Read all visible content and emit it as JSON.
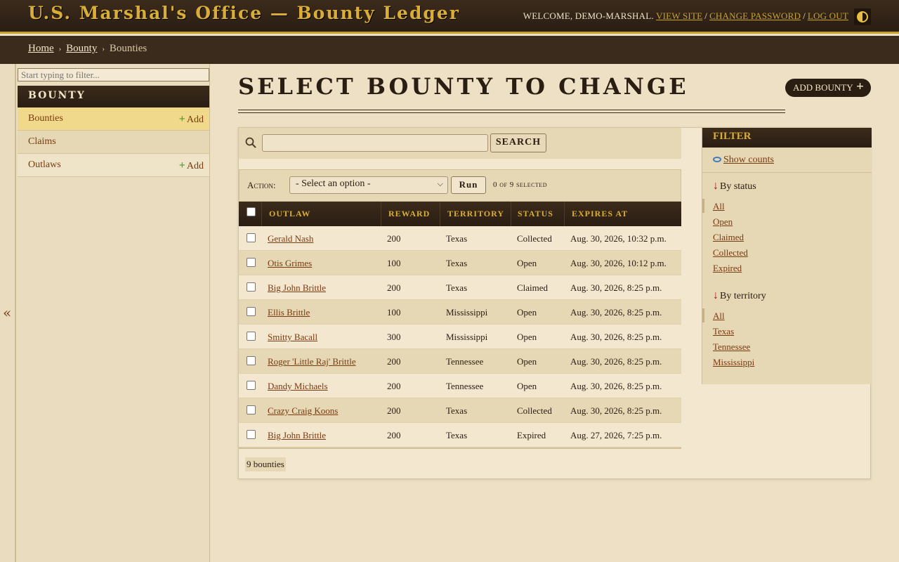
{
  "header": {
    "brand": "U.S. Marshal's Office — Bounty Ledger",
    "welcome": "Welcome, demo-marshal.",
    "view_site": "View site",
    "change_password": "Change password",
    "log_out": "Log out",
    "sep": "/"
  },
  "breadcrumbs": {
    "home": "Home",
    "app": "Bounty",
    "current": "Bounties",
    "arrow": "›"
  },
  "sidebar": {
    "filter_placeholder": "Start typing to filter...",
    "app_caption": "Bounty",
    "items": [
      {
        "label": "Bounties",
        "add": "Add"
      },
      {
        "label": "Claims"
      },
      {
        "label": "Outlaws",
        "add": "Add"
      }
    ],
    "collapse_glyph": "«"
  },
  "content": {
    "title": "Select bounty to change",
    "add_button": "Add bounty",
    "plus": "+",
    "search_button": "Search",
    "action_label": "Action:",
    "action_select": "- Select an option -",
    "run_button": "Run",
    "action_counter": "0 of 9 selected",
    "columns": [
      "Outlaw",
      "Reward",
      "Territory",
      "Status",
      "Expires at"
    ],
    "rows": [
      {
        "outlaw": "Gerald Nash",
        "reward": "200",
        "territory": "Texas",
        "status": "Collected",
        "expires": "Aug. 30, 2026, 10:32 p.m."
      },
      {
        "outlaw": "Otis Grimes",
        "reward": "100",
        "territory": "Texas",
        "status": "Open",
        "expires": "Aug. 30, 2026, 10:12 p.m."
      },
      {
        "outlaw": "Big John Brittle",
        "reward": "200",
        "territory": "Texas",
        "status": "Claimed",
        "expires": "Aug. 30, 2026, 8:25 p.m."
      },
      {
        "outlaw": "Ellis Brittle",
        "reward": "100",
        "territory": "Mississippi",
        "status": "Open",
        "expires": "Aug. 30, 2026, 8:25 p.m."
      },
      {
        "outlaw": "Smitty Bacall",
        "reward": "300",
        "territory": "Mississippi",
        "status": "Open",
        "expires": "Aug. 30, 2026, 8:25 p.m."
      },
      {
        "outlaw": "Roger 'Little Raj' Brittle",
        "reward": "200",
        "territory": "Tennessee",
        "status": "Open",
        "expires": "Aug. 30, 2026, 8:25 p.m."
      },
      {
        "outlaw": "Dandy Michaels",
        "reward": "200",
        "territory": "Tennessee",
        "status": "Open",
        "expires": "Aug. 30, 2026, 8:25 p.m."
      },
      {
        "outlaw": "Crazy Craig Koons",
        "reward": "200",
        "territory": "Texas",
        "status": "Collected",
        "expires": "Aug. 30, 2026, 8:25 p.m."
      },
      {
        "outlaw": "Big John Brittle",
        "reward": "200",
        "territory": "Texas",
        "status": "Expired",
        "expires": "Aug. 27, 2026, 7:25 p.m."
      }
    ],
    "paginator": "9 bounties"
  },
  "filter": {
    "title": "Filter",
    "show_counts": "Show counts",
    "arrow": "↓",
    "by_status": "By status",
    "status_options": [
      "All",
      "Open",
      "Claimed",
      "Collected",
      "Expired"
    ],
    "by_territory": "By territory",
    "territory_options": [
      "All",
      "Texas",
      "Tennessee",
      "Mississippi"
    ]
  },
  "colors": {
    "accent_gold": "#d9ad36",
    "dark_brown": "#2a1d12",
    "link": "#7a3a10"
  }
}
